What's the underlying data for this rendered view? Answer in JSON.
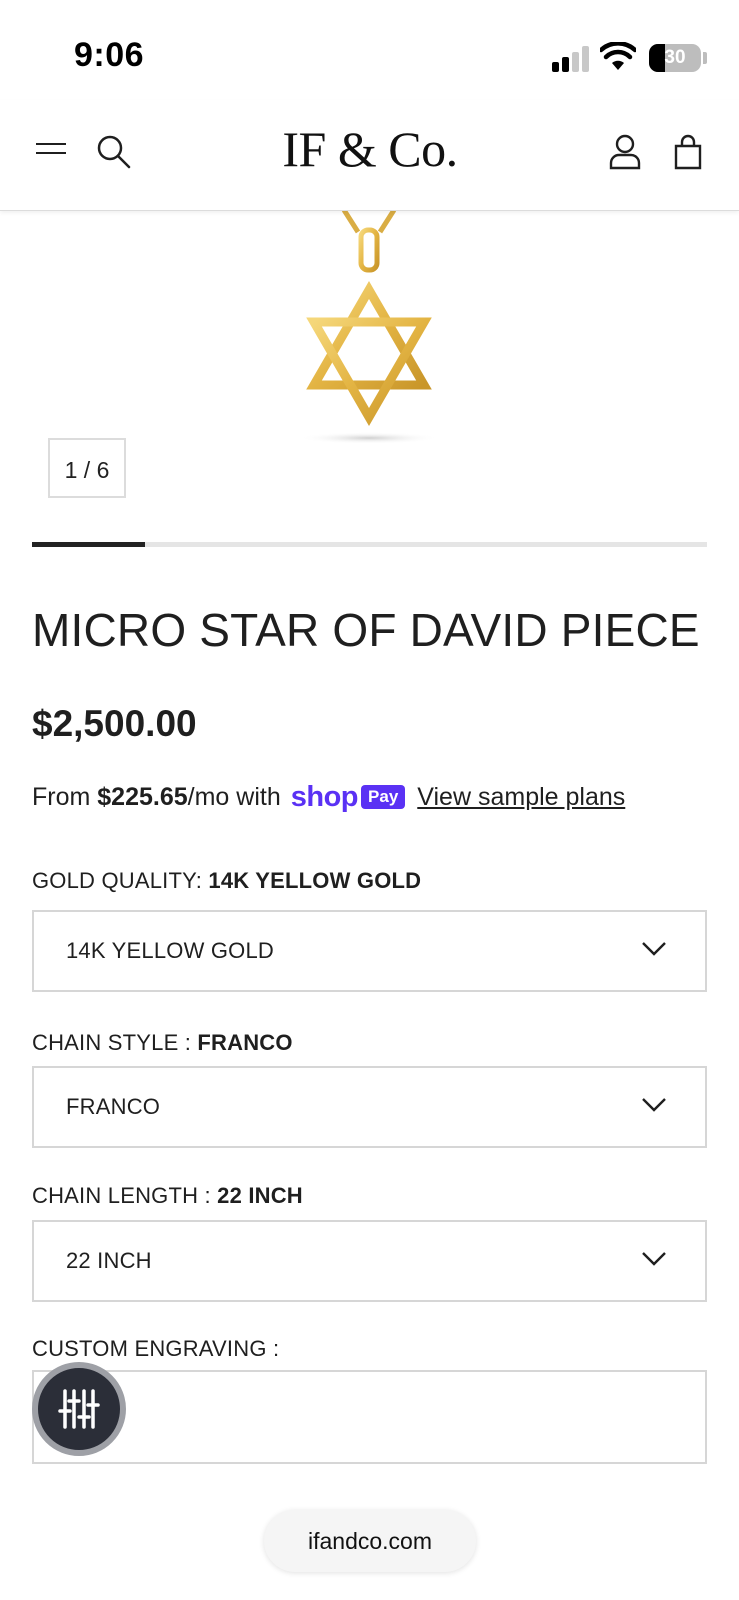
{
  "status_bar": {
    "time": "9:06",
    "battery_percent": "30"
  },
  "header": {
    "logo": "IF & Co."
  },
  "gallery": {
    "counter": "1 / 6",
    "progress_fraction": 0.167
  },
  "product": {
    "title": "MICRO STAR OF DAVID PIECE",
    "price": "$2,500.00",
    "installment_prefix": "From ",
    "installment_amount": "$225.65",
    "installment_suffix": "/mo with",
    "shop_word": "shop",
    "pay_word": "Pay",
    "sample_link": "View sample plans",
    "shop_pay_color": "#5a31f4"
  },
  "options": {
    "gold_quality": {
      "label": "GOLD QUALITY: ",
      "selected": "14K YELLOW GOLD",
      "value": "14K YELLOW GOLD"
    },
    "chain_style": {
      "label": "CHAIN STYLE : ",
      "selected": "FRANCO",
      "value": "FRANCO"
    },
    "chain_length": {
      "label": "CHAIN LENGTH : ",
      "selected": "22 INCH",
      "value": "22 INCH"
    },
    "engraving": {
      "label": "CUSTOM ENGRAVING :",
      "value": ""
    }
  },
  "browser": {
    "url": "ifandco.com"
  },
  "colors": {
    "gold": "#e6b94a",
    "text": "#1f1f1f",
    "border": "#d6d6d6"
  }
}
